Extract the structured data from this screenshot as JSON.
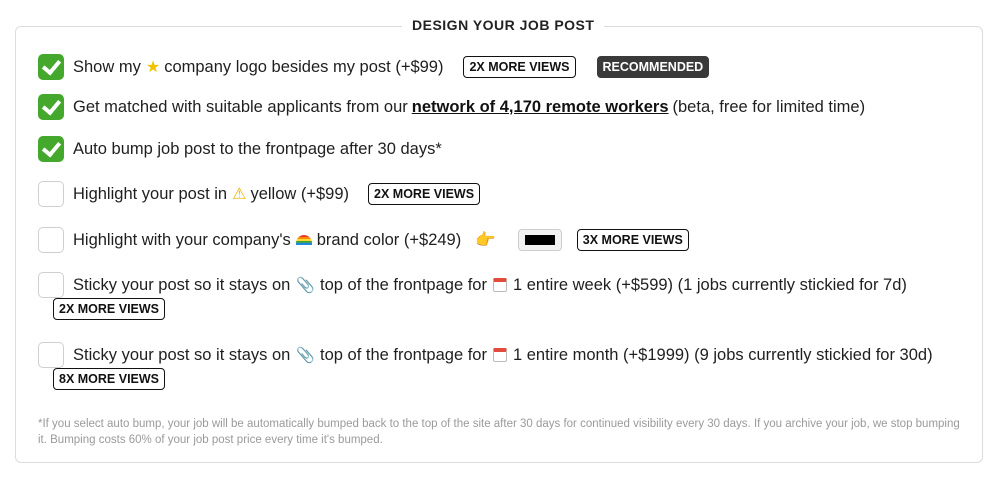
{
  "section": {
    "title": "DESIGN YOUR JOB POST"
  },
  "options": [
    {
      "checked": true,
      "text": "Show my",
      "icon": "star-icon",
      "icon_glyph": "★",
      "text2": "company logo besides my post (+$99)",
      "badges": [
        "2X MORE VIEWS",
        "RECOMMENDED"
      ]
    },
    {
      "checked": true,
      "text": "Get matched with suitable applicants from our",
      "link": "network of 4,170 remote workers",
      "text2": "(beta, free for limited time)"
    },
    {
      "checked": true,
      "text": "Auto bump job post to the frontpage after 30 days*"
    },
    {
      "checked": false,
      "text": "Highlight your post in",
      "icon": "warning-icon",
      "icon_glyph": "⚠",
      "text2": "yellow (+$99)",
      "badges": [
        "2X MORE VIEWS"
      ]
    },
    {
      "checked": false,
      "text": "Highlight with your company's",
      "icon": "rainbow-icon",
      "text2": "brand color (+$249)",
      "hand_glyph": "👉",
      "color_value": "#000000",
      "badges": [
        "3X MORE VIEWS"
      ]
    },
    {
      "checked": false,
      "text": "Sticky your post so it stays on",
      "icon": "paperclip-icon",
      "icon_glyph": "📎",
      "text2": "top of the frontpage for",
      "icon2": "calendar-icon",
      "text3": "1 entire week (+$599) (1 jobs currently stickied for 7d)",
      "badges": [
        "2X MORE VIEWS"
      ]
    },
    {
      "checked": false,
      "text": "Sticky your post so it stays on",
      "icon": "paperclip-icon",
      "icon_glyph": "📎",
      "text2": "top of the frontpage for",
      "icon2": "calendar-icon",
      "text3": "1 entire month (+$1999) (9 jobs currently stickied for 30d)",
      "badges": [
        "8X MORE VIEWS"
      ]
    }
  ],
  "footnote": "*If you select auto bump, your job will be automatically bumped back to the top of the site after 30 days for continued visibility every 30 days. If you archive your job, we stop bumping it. Bumping costs 60% of your job post price every time it's bumped.",
  "colors": {
    "check_green": "#43a82b",
    "badge_dark": "#3a3a3a",
    "brand_color": "#000000"
  }
}
